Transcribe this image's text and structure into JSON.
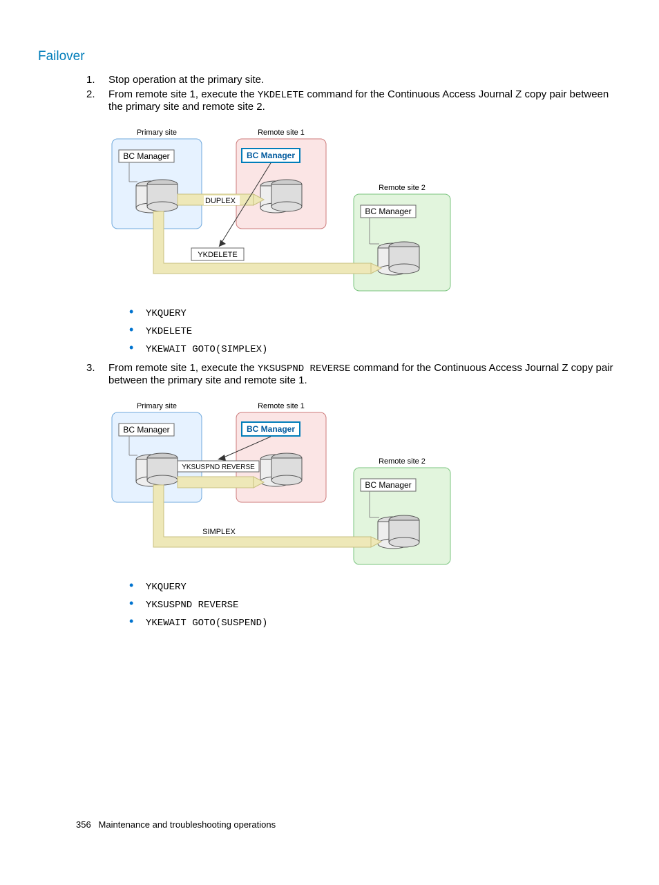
{
  "heading": "Failover",
  "steps": [
    {
      "text": "Stop operation at the primary site."
    },
    {
      "text_pre": "From remote site 1, execute the ",
      "code1": "YKDELETE",
      "text_post": " command for the Continuous Access Journal Z copy pair between the primary site and remote site 2.",
      "diagram": {
        "primary_label": "Primary site",
        "remote1_label": "Remote site 1",
        "remote2_label": "Remote site 2",
        "bc": "BC Manager",
        "state_label": "DUPLEX",
        "action_label": "YKDELETE"
      },
      "bullets": [
        "YKQUERY",
        "YKDELETE",
        "YKEWAIT GOTO(SIMPLEX)"
      ]
    },
    {
      "text_pre": "From remote site 1, execute the ",
      "code1": "YKSUSPND REVERSE",
      "text_post": " command for the Continuous Access Journal Z copy pair between the primary site and remote site 1.",
      "diagram": {
        "primary_label": "Primary site",
        "remote1_label": "Remote site 1",
        "remote2_label": "Remote site 2",
        "bc": "BC Manager",
        "state_label": "YKSUSPND REVERSE",
        "action_label": "SIMPLEX"
      },
      "bullets": [
        "YKQUERY",
        "YKSUSPND REVERSE",
        "YKEWAIT GOTO(SUSPEND)"
      ]
    }
  ],
  "footer": {
    "page": "356",
    "section": "Maintenance and troubleshooting operations"
  }
}
